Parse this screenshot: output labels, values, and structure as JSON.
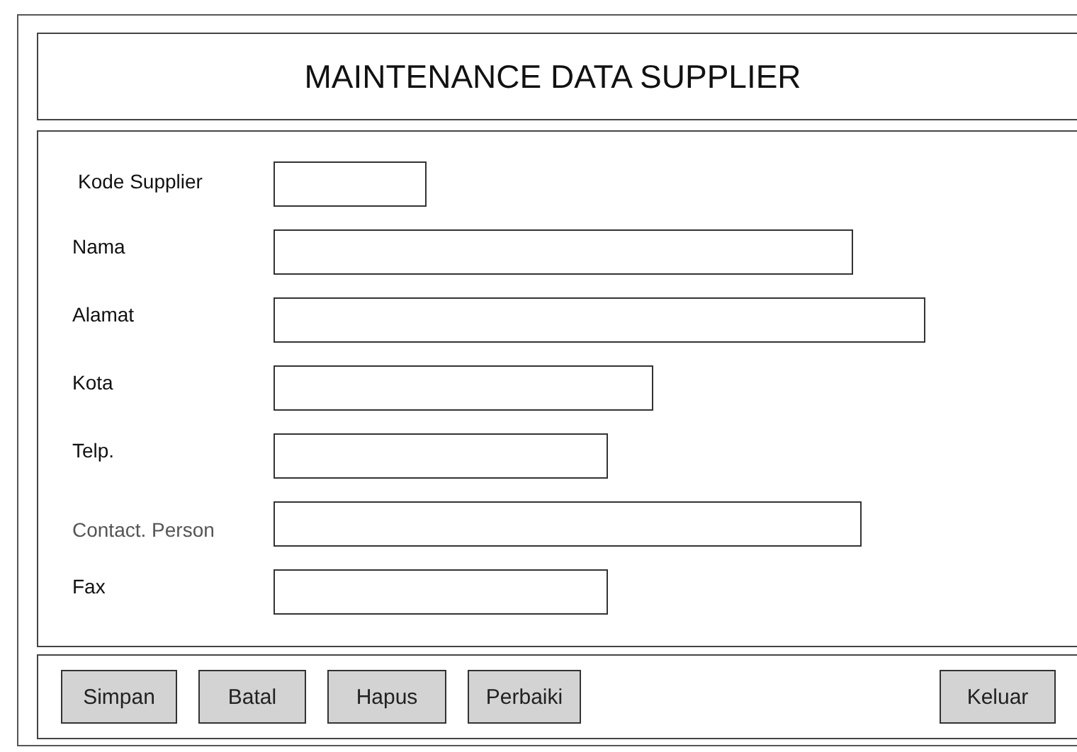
{
  "title": "MAINTENANCE DATA SUPPLIER",
  "fields": [
    {
      "label": "Kode Supplier",
      "dimmed": false
    },
    {
      "label": "Nama",
      "dimmed": false
    },
    {
      "label": "Alamat",
      "dimmed": false
    },
    {
      "label": "Kota",
      "dimmed": false
    },
    {
      "label": "Telp.",
      "dimmed": false
    },
    {
      "label": "Contact. Person",
      "dimmed": true
    },
    {
      "label": "Fax",
      "dimmed": false
    }
  ],
  "buttons": [
    {
      "label": "Simpan",
      "kind": "action"
    },
    {
      "label": "Batal",
      "kind": "action"
    },
    {
      "label": "Hapus",
      "kind": "action"
    },
    {
      "label": "Perbaiki",
      "kind": "action"
    },
    {
      "label": "Keluar",
      "kind": "exit"
    }
  ]
}
